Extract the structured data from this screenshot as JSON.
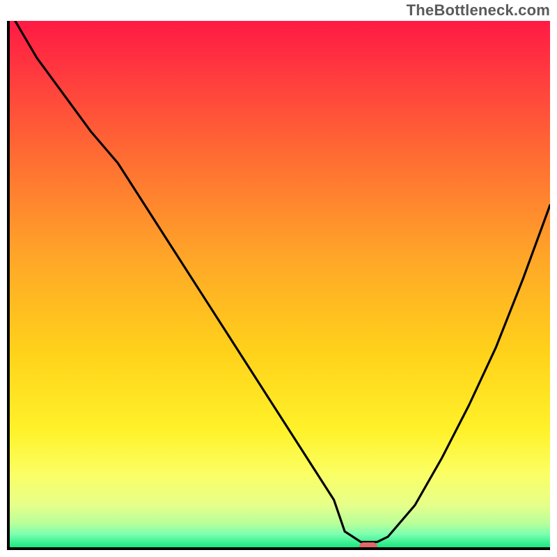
{
  "watermark": "TheBottleneck.com",
  "colors": {
    "gradient_stops": [
      {
        "offset": 0.0,
        "color": "#ff1a44"
      },
      {
        "offset": 0.1,
        "color": "#ff3a3f"
      },
      {
        "offset": 0.25,
        "color": "#ff6a33"
      },
      {
        "offset": 0.45,
        "color": "#ffa628"
      },
      {
        "offset": 0.63,
        "color": "#ffd21a"
      },
      {
        "offset": 0.78,
        "color": "#fff22a"
      },
      {
        "offset": 0.86,
        "color": "#fbff64"
      },
      {
        "offset": 0.92,
        "color": "#e6ff8a"
      },
      {
        "offset": 0.955,
        "color": "#b8ff9a"
      },
      {
        "offset": 0.975,
        "color": "#7bffb0"
      },
      {
        "offset": 1.0,
        "color": "#18e880"
      }
    ],
    "line": "#000000",
    "marker": "#e06868",
    "axes": "#000000"
  },
  "chart_data": {
    "type": "line",
    "title": "",
    "xlabel": "",
    "ylabel": "",
    "xlim": [
      0,
      100
    ],
    "ylim": [
      0,
      100
    ],
    "x": [
      1,
      5,
      10,
      15,
      20,
      25,
      30,
      35,
      40,
      45,
      50,
      55,
      60,
      62,
      65,
      68,
      70,
      75,
      80,
      85,
      90,
      95,
      100
    ],
    "values": [
      100,
      93,
      86,
      79,
      73,
      65,
      57,
      49,
      41,
      33,
      25,
      17,
      9,
      3,
      1,
      1,
      2,
      8,
      17,
      27,
      38,
      51,
      65
    ],
    "marker": {
      "x": 66,
      "y": 0.6
    },
    "notes": "Axis tick labels and units are not shown in the image; values are estimated from pixel positions relative to the plot frame."
  }
}
